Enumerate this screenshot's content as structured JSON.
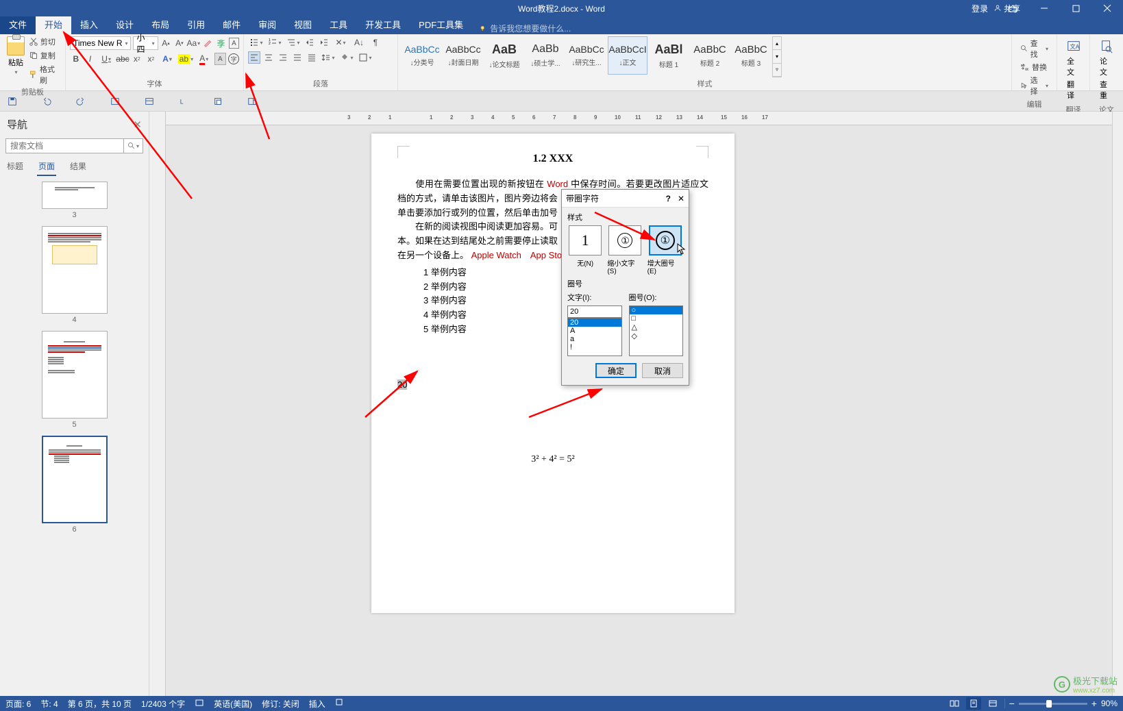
{
  "app": {
    "title": "Word教程2.docx - Word"
  },
  "login": {
    "login": "登录",
    "share": "共享"
  },
  "menus": {
    "file": "文件",
    "home": "开始",
    "insert": "插入",
    "design": "设计",
    "layout": "布局",
    "refs": "引用",
    "mail": "邮件",
    "review": "审阅",
    "view": "视图",
    "tools": "工具",
    "dev": "开发工具",
    "pdf": "PDF工具集",
    "tellme": "告诉我您想要做什么..."
  },
  "ribbon": {
    "clipboard": {
      "label": "剪贴板",
      "paste": "粘贴",
      "cut": "剪切",
      "copy": "复制",
      "painter": "格式刷"
    },
    "font": {
      "label": "字体",
      "family": "Times New R",
      "size": "小四"
    },
    "paragraph": {
      "label": "段落"
    },
    "styles": {
      "label": "样式",
      "items": [
        {
          "preview": "AaBbCc",
          "name": "↓分类号",
          "cls": "blue"
        },
        {
          "preview": "AaBbCc",
          "name": "↓封面日期",
          "cls": ""
        },
        {
          "preview": "AaB",
          "name": "↓论文标题",
          "cls": "big"
        },
        {
          "preview": "AaBb",
          "name": "↓硕士学...",
          "cls": ""
        },
        {
          "preview": "AaBbCc",
          "name": "↓研究生...",
          "cls": ""
        },
        {
          "preview": "AaBbCcI",
          "name": "↓正文",
          "cls": ""
        },
        {
          "preview": "AaBl",
          "name": "标题 1",
          "cls": "big"
        },
        {
          "preview": "AaBbC",
          "name": "标题 2",
          "cls": ""
        },
        {
          "preview": "AaBbC",
          "name": "标题 3",
          "cls": ""
        }
      ]
    },
    "editing": {
      "label": "编辑",
      "find": "查找",
      "replace": "替换",
      "select": "选择"
    },
    "translate": {
      "label": "翻译",
      "full": "全文",
      "fan": "翻译"
    },
    "check": {
      "label": "论文",
      "l1": "论文",
      "l2": "查重"
    }
  },
  "nav": {
    "title": "导航",
    "search_ph": "搜索文档",
    "tabs": {
      "headings": "标题",
      "pages": "页面",
      "results": "结果"
    },
    "thumbs": [
      {
        "n": "3",
        "sel": false
      },
      {
        "n": "4",
        "sel": false
      },
      {
        "n": "5",
        "sel": false
      },
      {
        "n": "6",
        "sel": true
      }
    ]
  },
  "document": {
    "title": "1.2 XXX",
    "para1_a": "使用在需要位置出现的新按钮在 ",
    "para1_word": "Word",
    "para1_b": " 中保存时间。若要更改图片适应文档的方式，请单击该图片，图片旁边将会",
    "para2": "单击要添加行或列的位置，然后单击加号",
    "para3": "在新的阅读视图中阅读更加容易。可",
    "para4_a": "本。如果在达到结尾处之前需要停止读取",
    "para4_b": "在另一个设备上。",
    "para4_aw": "Apple Watch",
    "para4_as": "App Stor",
    "list": [
      "1 举例内容",
      "2 举例内容",
      "3 举例内容",
      "4 举例内容",
      "5 举例内容"
    ],
    "seltext": "20",
    "equation": "3² + 4² = 5²"
  },
  "dialog": {
    "title": "带圈字符",
    "style_label": "样式",
    "opts": {
      "none": "无(N)",
      "shrink": "缩小文字(S)",
      "enlarge": "增大圈号(E)"
    },
    "enc_label": "圈号",
    "text_label": "文字(I):",
    "ring_label": "圈号(O):",
    "text_value": "20",
    "text_items": [
      "20",
      "A",
      "a",
      "!"
    ],
    "ring_items": [
      "○",
      "□",
      "△",
      "◇"
    ],
    "ok": "确定",
    "cancel": "取消"
  },
  "status": {
    "page": "页面: 6",
    "section": "节: 4",
    "pageof": "第 6 页，共 10 页",
    "words": "1/2403 个字",
    "lang": "英语(美国)",
    "track": "修订: 关闭",
    "ins": "插入",
    "zoom": "90%"
  },
  "watermark": {
    "name": "极光下载站",
    "url": "www.xz7.com"
  }
}
